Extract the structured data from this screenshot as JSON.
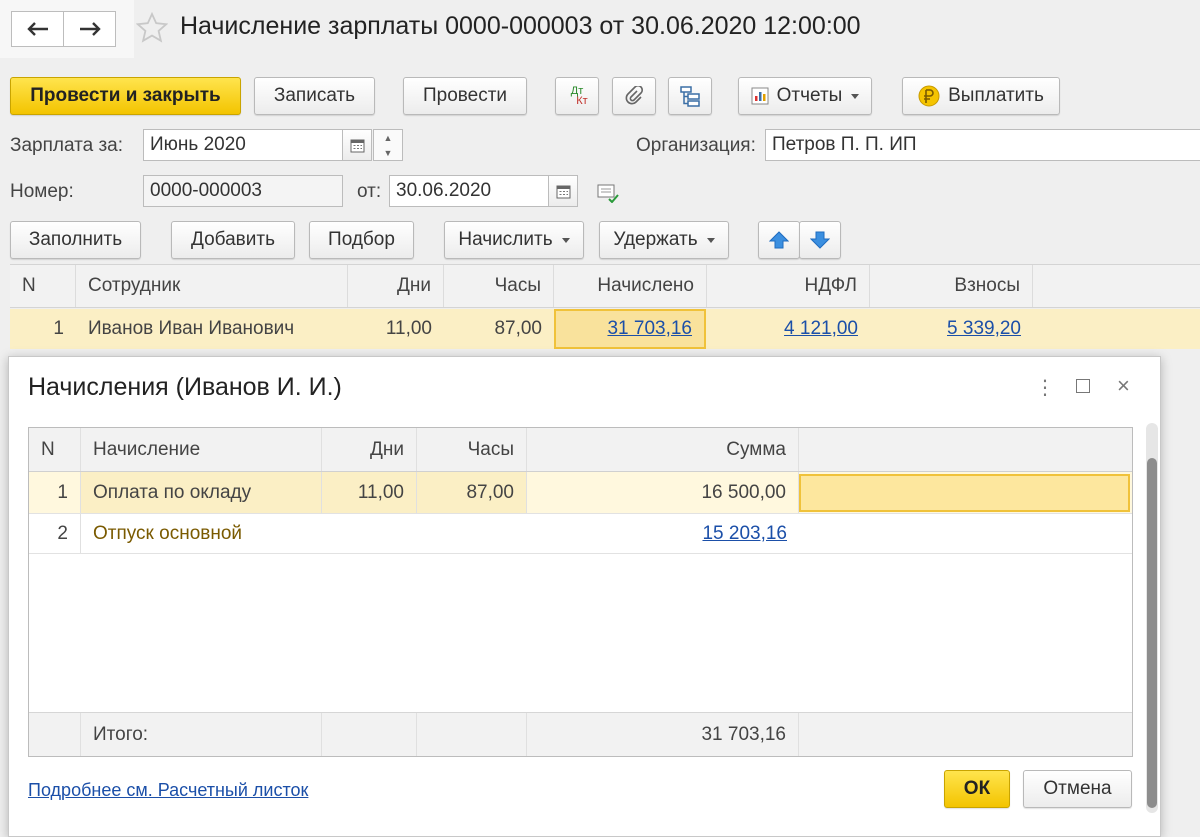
{
  "window": {
    "title": "Начисление зарплаты 0000-000003 от 30.06.2020 12:00:00"
  },
  "toolbar": {
    "post_close": "Провести и закрыть",
    "save": "Записать",
    "post": "Провести",
    "dtkt_top": "Дт",
    "dtkt_bottom": "Кт",
    "reports": "Отчеты",
    "pay": "Выплатить"
  },
  "form": {
    "salary_for_label": "Зарплата за:",
    "salary_for_value": "Июнь 2020",
    "org_label": "Организация:",
    "org_value": "Петров П. П. ИП",
    "number_label": "Номер:",
    "number_value": "0000-000003",
    "date_label": "от:",
    "date_value": "30.06.2020"
  },
  "table_toolbar": {
    "fill": "Заполнить",
    "add": "Добавить",
    "select": "Подбор",
    "accrue": "Начислить",
    "withhold": "Удержать"
  },
  "main_table": {
    "headers": [
      "N",
      "Сотрудник",
      "Дни",
      "Часы",
      "Начислено",
      "НДФЛ",
      "Взносы"
    ],
    "rows": [
      {
        "n": "1",
        "employee": "Иванов Иван Иванович",
        "days": "11,00",
        "hours": "87,00",
        "accrued": "31 703,16",
        "ndfl": "4 121,00",
        "contrib": "5 339,20"
      }
    ]
  },
  "modal": {
    "title": "Начисления (Иванов И. И.)",
    "headers": [
      "N",
      "Начисление",
      "Дни",
      "Часы",
      "Сумма"
    ],
    "rows": [
      {
        "n": "1",
        "name": "Оплата по окладу",
        "days": "11,00",
        "hours": "87,00",
        "sum": "16 500,00"
      },
      {
        "n": "2",
        "name": "Отпуск основной",
        "days": "",
        "hours": "",
        "sum": "15 203,16"
      }
    ],
    "total_label": "Итого:",
    "total_sum": "31 703,16",
    "details_link": "Подробнее см. Расчетный листок",
    "ok": "ОК",
    "cancel": "Отмена"
  },
  "colors": {
    "accent_yellow": "#f3c400",
    "row_highlight": "#fbefc5",
    "link_blue": "#1b4fa8",
    "vacation_text": "#7a5a00"
  }
}
